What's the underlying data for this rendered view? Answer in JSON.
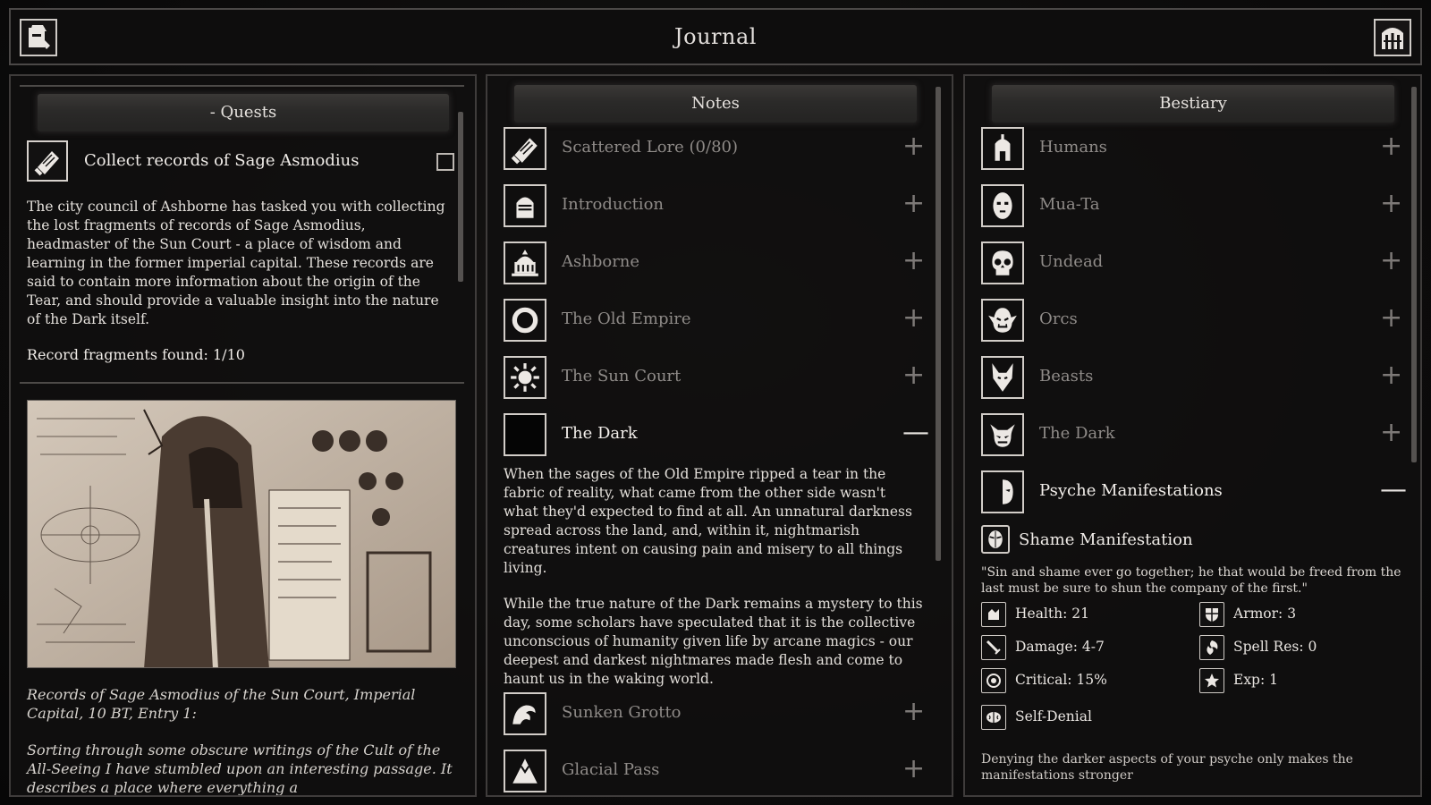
{
  "header": {
    "title": "Journal",
    "left_icon": "helmet-scroll-icon",
    "right_icon": "gate-icon"
  },
  "quests": {
    "heading": "- Quests",
    "quest": {
      "title": "Collect records of Sage Asmodius",
      "icon": "scroll-icon",
      "description": "The city council of Ashborne has tasked you with collecting the lost fragments of records of Sage Asmodius, headmaster of the Sun Court - a place of wisdom and learning in the former imperial capital. These records are said to contain more information about the origin of the Tear, and should provide a valuable insight into the nature of the Dark itself.",
      "fragments": "Record fragments found: 1/10",
      "completed": false
    },
    "caption": "Records of Sage Asmodius of the Sun Court, Imperial Capital, 10 BT, Entry 1:",
    "entry": "Sorting through some obscure writings of the Cult of the All-Seeing I have stumbled upon an interesting passage. It describes a place where everything a"
  },
  "notes": {
    "heading": "Notes",
    "items": [
      {
        "label": "Scattered Lore (0/80)",
        "icon": "scroll-icon",
        "toggle": "+"
      },
      {
        "label": "Introduction",
        "icon": "knight-helmet-icon",
        "toggle": "+"
      },
      {
        "label": "Ashborne",
        "icon": "temple-icon",
        "toggle": "+"
      },
      {
        "label": "The Old Empire",
        "icon": "ouroboros-icon",
        "toggle": "+"
      },
      {
        "label": "The Sun Court",
        "icon": "sun-icon",
        "toggle": "+"
      },
      {
        "label": "The Dark",
        "icon": "black-square-icon",
        "toggle": "—"
      },
      {
        "label": "Sunken Grotto",
        "icon": "wave-icon",
        "toggle": "+"
      },
      {
        "label": "Glacial Pass",
        "icon": "mountain-icon",
        "toggle": "+"
      }
    ],
    "dark_text_1": "When the sages of the Old Empire ripped a tear in the fabric of reality, what came from the other side wasn't what they'd expected to find at all. An unnatural darkness spread across the land, and, within it, nightmarish creatures intent on causing pain and misery to all things living.",
    "dark_text_2": "While the true nature of the Dark remains a mystery to this day, some scholars have speculated that it is the collective unconscious of humanity given life by arcane magics - our deepest and darkest nightmares made flesh and come to haunt us in the waking world."
  },
  "bestiary": {
    "heading": "Bestiary",
    "items": [
      {
        "label": "Humans",
        "icon": "spartan-helmet-icon",
        "toggle": "+"
      },
      {
        "label": "Mua-Ta",
        "icon": "tribal-mask-icon",
        "toggle": "+"
      },
      {
        "label": "Undead",
        "icon": "skull-icon",
        "toggle": "+"
      },
      {
        "label": "Orcs",
        "icon": "orc-head-icon",
        "toggle": "+"
      },
      {
        "label": "Beasts",
        "icon": "wolf-head-icon",
        "toggle": "+"
      },
      {
        "label": "The Dark",
        "icon": "demon-skull-icon",
        "toggle": "+"
      },
      {
        "label": "Psyche Manifestations",
        "icon": "half-mask-icon",
        "toggle": "—"
      }
    ],
    "manifestation": {
      "name": "Shame Manifestation",
      "icon": "shame-mask-icon",
      "quote": "\"Sin and shame ever go together; he that would be freed from the last must be sure to shun the company of the first.\"",
      "stats": {
        "health": "Health: 21",
        "armor": "Armor: 3",
        "damage": "Damage: 4-7",
        "spell_res": "Spell Res: 0",
        "critical": "Critical: 15%",
        "exp": "Exp: 1"
      },
      "trait": "Self-Denial",
      "trait_desc": "Denying the darker aspects of your psyche only makes the manifestations stronger"
    }
  }
}
